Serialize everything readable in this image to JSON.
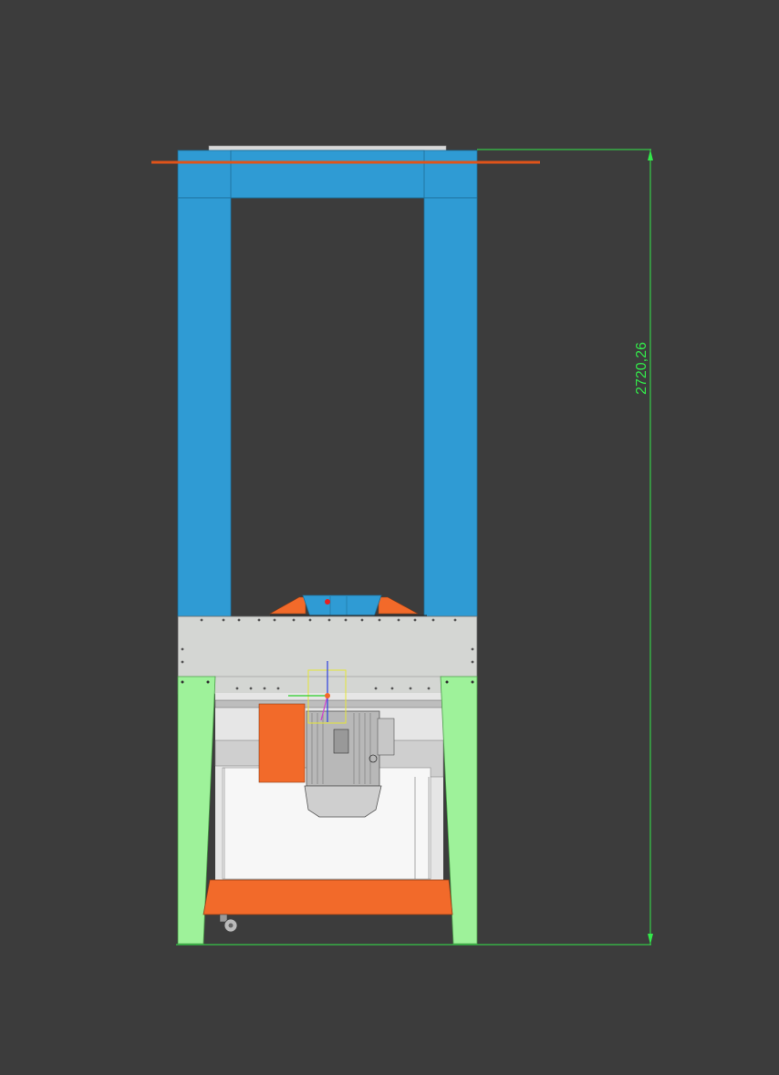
{
  "viewport": {
    "background": "#3c3c3c"
  },
  "dimension": {
    "label": "2720,26",
    "color": "#33e84a"
  },
  "colors": {
    "frame_blue": "#2f9bd4",
    "legs_green": "#9ef29a",
    "orange_parts": "#f26a2a",
    "housing_gray": "#d4d6d3",
    "interior_light": "#f2f2f2",
    "section_line": "#e0541a",
    "motor_gray": "#b8b8b8"
  },
  "parts": [
    {
      "name": "overhead-gantry-frame",
      "color_key": "frame_blue"
    },
    {
      "name": "motor-housing-panel",
      "color_key": "housing_gray"
    },
    {
      "name": "support-legs",
      "color_key": "legs_green"
    },
    {
      "name": "electric-motor",
      "color_key": "motor_gray"
    },
    {
      "name": "base-tray",
      "color_key": "orange_parts"
    }
  ]
}
